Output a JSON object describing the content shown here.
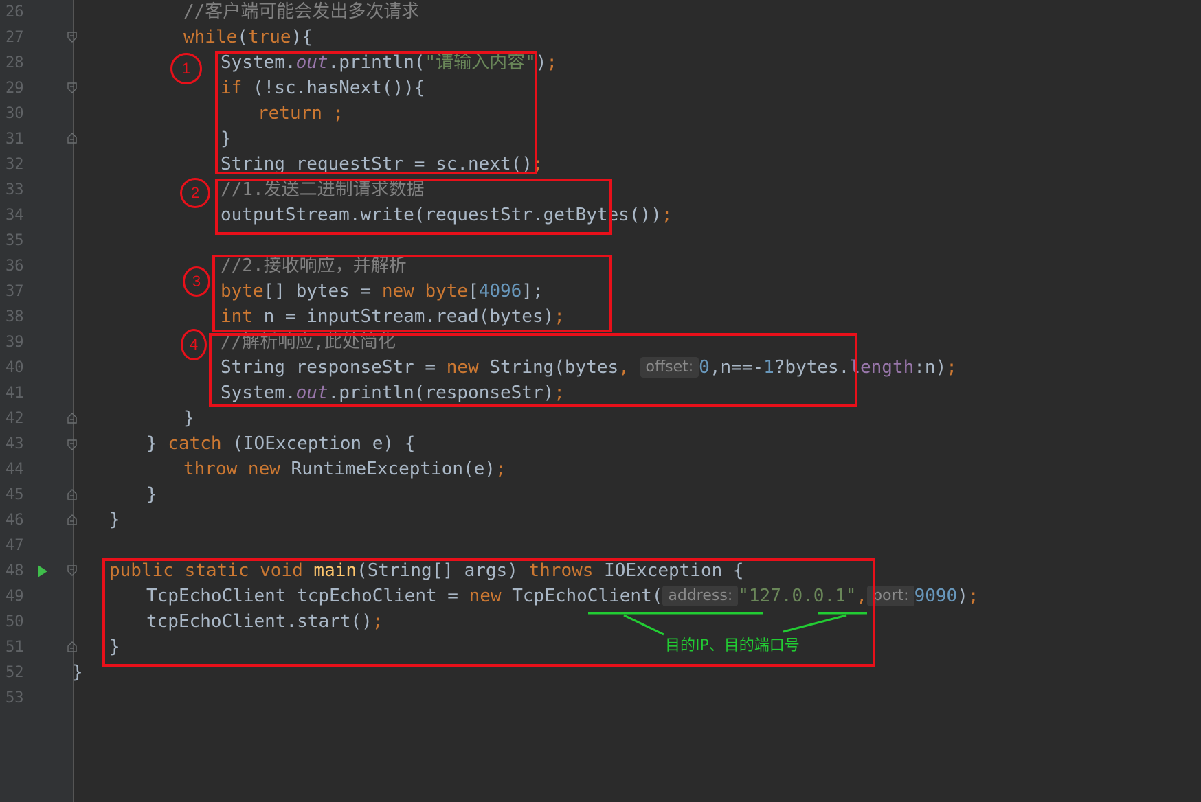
{
  "gutter": {
    "line_numbers": [
      "26",
      "27",
      "28",
      "29",
      "30",
      "31",
      "32",
      "33",
      "34",
      "35",
      "36",
      "37",
      "38",
      "39",
      "40",
      "41",
      "42",
      "43",
      "44",
      "45",
      "46",
      "47",
      "48",
      "49",
      "50",
      "51",
      "52",
      "53"
    ]
  },
  "code": {
    "l26_comment": "//客户端可能会发出多次请求",
    "l27_while": "while",
    "l27_lp": "(",
    "l27_true": "true",
    "l27_rest": "){",
    "l28_system": "System.",
    "l28_out": "out",
    "l28_println": ".println(",
    "l28_str": "\"请输入内容\"",
    "l28_close": ")",
    "l28_semi": ";",
    "l29_if": "if",
    "l29_rest": " (!sc.hasNext()){",
    "l30_return": "return ;",
    "l31_brace": "}",
    "l32_text": "String requestStr = sc.next()",
    "l32_semi": ";",
    "l33_comment": "//1.发送二进制请求数据",
    "l34_text": "outputStream.write(requestStr.getBytes())",
    "l34_semi": ";",
    "l36_comment": "//2.接收响应，并解析",
    "l37_byte1": "byte",
    "l37_mid": "[] bytes = ",
    "l37_new": "new ",
    "l37_byte2": "byte",
    "l37_lb": "[",
    "l37_num": "4096",
    "l37_end": "];",
    "l38_int": "int",
    "l38_rest": " n = inputStream.read(bytes)",
    "l38_semi": ";",
    "l39_comment": "//解析响应,此处简化",
    "l40_a": "String responseStr = ",
    "l40_new": "new ",
    "l40_b": "String(bytes",
    "l40_comma": ", ",
    "l40_hint": "offset:",
    "l40_zero": "0",
    "l40_c": ",n==-",
    "l40_one": "1",
    "l40_d": "?bytes.",
    "l40_length": "length",
    "l40_e": ":n)",
    "l40_semi": ";",
    "l41_system": "System.",
    "l41_out": "out",
    "l41_rest": ".println(responseStr)",
    "l41_semi": ";",
    "l42_brace": "}",
    "l43_a": "} ",
    "l43_catch": "catch",
    "l43_b": " (IOException e) {",
    "l44_throw": "throw new ",
    "l44_rest": "RuntimeException(e)",
    "l44_semi": ";",
    "l45_brace": "}",
    "l46_brace": "}",
    "l48_kw": "public static void ",
    "l48_main": "main",
    "l48_mid": "(String[] args) ",
    "l48_throws": "throws",
    "l48_end": " IOException {",
    "l49_a": "TcpEchoClient tcpEchoClient = ",
    "l49_new": "new ",
    "l49_b": "TcpEchoClient(",
    "l49_hint1": "address:",
    "l49_str": "\"127.0.0.1\"",
    "l49_comma": ",",
    "l49_hint2": "port:",
    "l49_num": "9090",
    "l49_close": ")",
    "l49_semi": ";",
    "l50_text": "tcpEchoClient.start()",
    "l50_semi": ";",
    "l51_brace": "}",
    "l52_brace": "}"
  },
  "annotations": {
    "circle_1": "1",
    "circle_2": "2",
    "circle_3": "3",
    "circle_4": "4",
    "green_note": "目的IP、目的端口号"
  },
  "colors": {
    "background": "#2b2b2b",
    "keyword": "#cc7832",
    "string": "#6a8759",
    "number": "#6897bb",
    "comment": "#808080",
    "field": "#9876aa",
    "method_decl": "#ffc66d",
    "annotation_red": "#e8101a",
    "annotation_green": "#22cc33"
  }
}
